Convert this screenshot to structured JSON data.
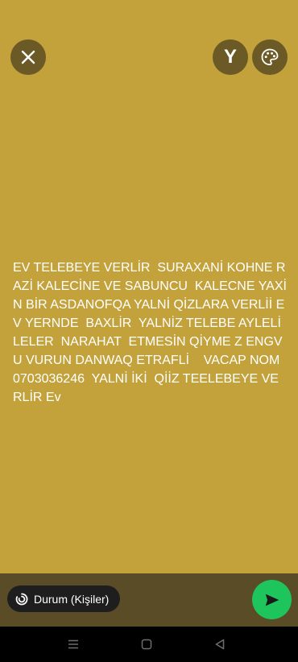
{
  "colors": {
    "background": "#c3a23c",
    "button_bg": "#6b5a25",
    "bottom_bar": "#5a4c27",
    "pill_bg": "#1e1e1e",
    "send_green": "#1ec45c",
    "nav_bar": "#000000"
  },
  "header": {
    "close_icon": "close-icon",
    "text_style_label": "Y",
    "palette_icon": "palette-icon"
  },
  "status": {
    "text": "EV TELEBEYE VERLİR  SURAXANİ KOHNE RAZİ KALECİNE VE SABUNCU  KALECNE YAXİN BİR ASDANOFQA YALNİ QİZLARA VERLİİ EV YERNDE  BAXLİR  YALNİZ TELEBE AYLELİLELER  NARAHAT  ETMESİN QİYME Z ENGVU VURUN DANWAQ ETRAFLİ    VACAP NOM 0703036246  YALNİ İKİ  QİİZ TEELEBEYE VERLİR Ev"
  },
  "footer": {
    "audience_label": "Durum (Kişiler)",
    "audience_icon": "status-ring-icon",
    "send_icon": "send-icon"
  },
  "nav": {
    "menu_icon": "recent-apps-icon",
    "home_icon": "home-icon",
    "back_icon": "back-icon"
  }
}
